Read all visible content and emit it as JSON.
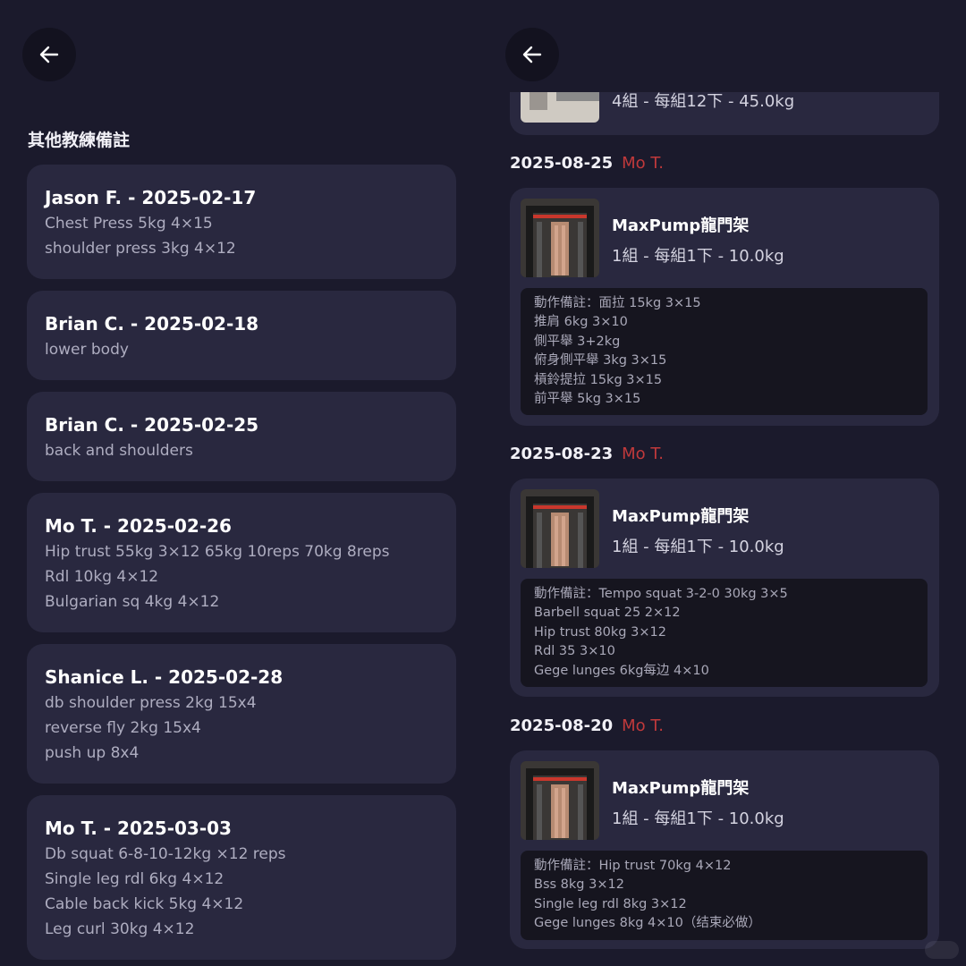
{
  "left": {
    "section_title": "其他教練備註",
    "notes": [
      {
        "head": "Jason F. - 2025-02-17",
        "lines": [
          "Chest Press 5kg 4×15",
          "shoulder press 3kg 4×12"
        ]
      },
      {
        "head": "Brian C. - 2025-02-18",
        "lines": [
          "lower body"
        ]
      },
      {
        "head": "Brian C. - 2025-02-25",
        "lines": [
          "back and shoulders"
        ]
      },
      {
        "head": "Mo T. - 2025-02-26",
        "lines": [
          "Hip trust 55kg 3×12 65kg 10reps 70kg 8reps",
          "Rdl 10kg 4×12",
          "Bulgarian sq 4kg 4×12"
        ]
      },
      {
        "head": "Shanice L. - 2025-02-28",
        "lines": [
          "db shoulder press 2kg 15x4",
          "reverse fly 2kg 15x4",
          "push up 8x4"
        ]
      },
      {
        "head": "Mo T. - 2025-03-03",
        "lines": [
          "Db squat 6-8-10-12kg ×12 reps",
          "Single leg rdl 6kg 4×12",
          "Cable back kick 5kg 4×12",
          "Leg curl 30kg 4×12"
        ]
      }
    ]
  },
  "right": {
    "top_card_sets": "4組 - 每組12下 - 45.0kg",
    "sessions": [
      {
        "date": "2025-08-25",
        "coach": "Mo T.",
        "exercise": "MaxPump龍門架",
        "sets": "1組 - 每組1下 - 10.0kg",
        "remarks": [
          "動作備註：面拉 15kg 3×15",
          "推肩 6kg 3×10",
          "側平舉 3+2kg",
          "俯身側平舉 3kg 3×15",
          "槓鈴提拉 15kg 3×15",
          "前平舉 5kg 3×15"
        ]
      },
      {
        "date": "2025-08-23",
        "coach": "Mo T.",
        "exercise": "MaxPump龍門架",
        "sets": "1組 - 每組1下 - 10.0kg",
        "remarks": [
          "動作備註：Tempo squat 3-2-0 30kg 3×5",
          "Barbell squat 25 2×12",
          "Hip trust 80kg 3×12",
          "Rdl 35 3×10",
          "Gege lunges 6kg每边 4×10"
        ]
      },
      {
        "date": "2025-08-20",
        "coach": "Mo T.",
        "exercise": "MaxPump龍門架",
        "sets": "1組 - 每組1下 - 10.0kg",
        "remarks": [
          "動作備註：Hip trust 70kg 4×12",
          "Bss 8kg 3×12",
          "Single leg rdl 8kg 3×12",
          "Gege lunges 8kg 4×10（结束必做）"
        ]
      }
    ]
  },
  "colors": {
    "background": "#1b1a2c",
    "card": "#29283f",
    "coach_accent": "#c0393b",
    "remark_bg": "#16151f"
  },
  "icons": {
    "back": "arrow-left-icon"
  }
}
